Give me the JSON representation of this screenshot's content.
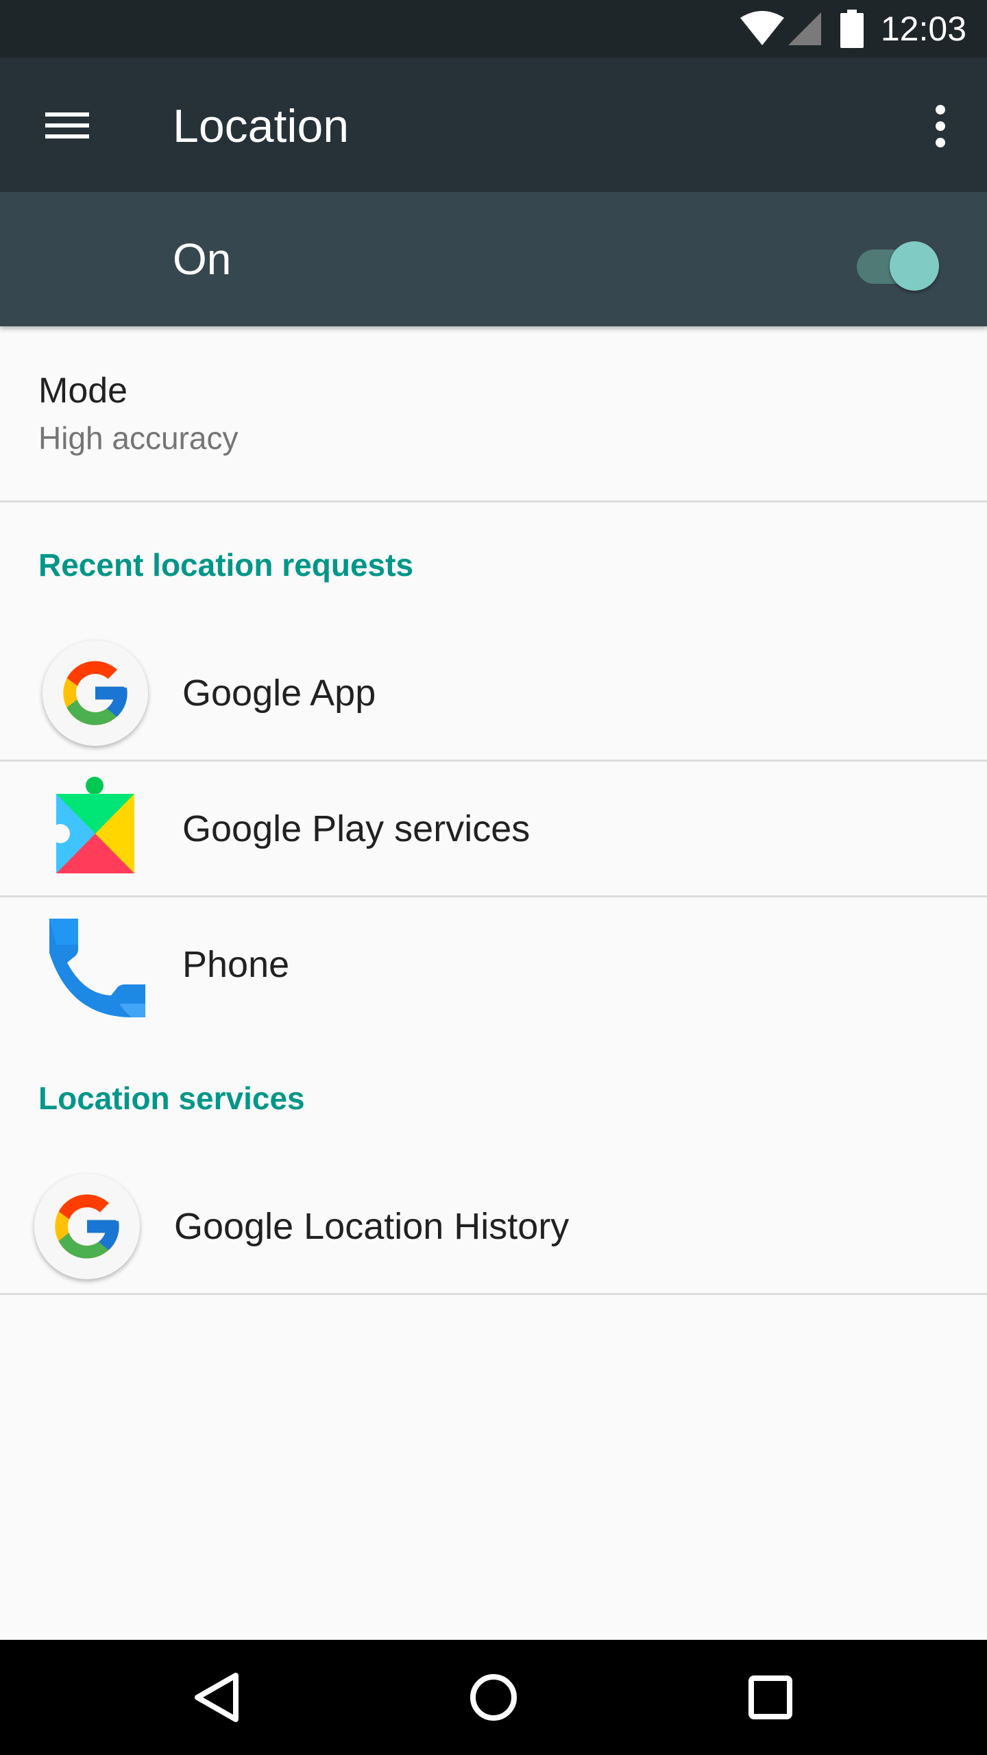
{
  "status_bar": {
    "time": "12:03",
    "icons": [
      "wifi-icon",
      "cell-signal-icon",
      "battery-icon"
    ]
  },
  "toolbar": {
    "title": "Location",
    "menu_icon": "hamburger-menu-icon",
    "overflow_icon": "more-vert-icon"
  },
  "master_switch": {
    "label": "On",
    "state": "on"
  },
  "mode": {
    "title": "Mode",
    "value": "High accuracy"
  },
  "recent_requests": {
    "header": "Recent location requests",
    "items": [
      {
        "label": "Google App",
        "icon": "google-g-icon"
      },
      {
        "label": "Google Play services",
        "icon": "google-play-services-icon"
      },
      {
        "label": "Phone",
        "icon": "phone-icon"
      }
    ]
  },
  "location_services": {
    "header": "Location services",
    "items": [
      {
        "label": "Google Location History",
        "icon": "google-g-icon"
      }
    ]
  },
  "colors": {
    "status_bar": "#1f262a",
    "toolbar": "#263238",
    "switch_bar": "#37474f",
    "accent": "#009688",
    "switch_thumb": "#80cbc4"
  },
  "nav_bar": {
    "buttons": [
      "back-icon",
      "home-icon",
      "recents-icon"
    ]
  }
}
